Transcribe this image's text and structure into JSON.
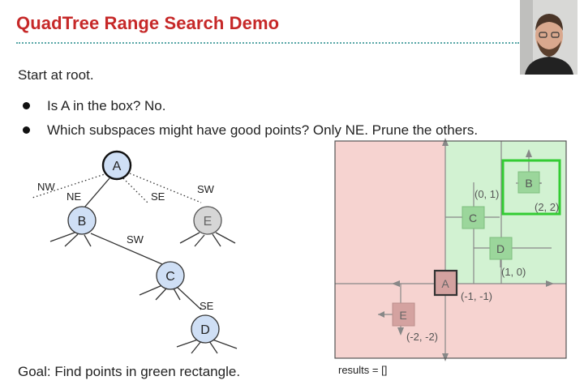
{
  "slide": {
    "title": "QuadTree Range Search Demo",
    "intro": "Start at root.",
    "bullets": [
      "Is A in the box? No.",
      "Which subspaces might have good points? Only NE. Prune the others."
    ],
    "goal": "Goal: Find points in green rectangle.",
    "results": "results = []"
  },
  "tree": {
    "nodes": {
      "A": "A",
      "B": "B",
      "C": "C",
      "D": "D",
      "E": "E"
    },
    "edge_labels": {
      "nw": "NW",
      "ne": "NE",
      "se": "SE",
      "sw": "SW",
      "b_sw": "SW",
      "c_se": "SE"
    }
  },
  "plot": {
    "points": {
      "A": "A",
      "B": "B",
      "C": "C",
      "D": "D",
      "E": "E"
    },
    "coords": {
      "a": "(-1, -1)",
      "b": "(2, 2)",
      "c": "(0, 1)",
      "d": "(1, 0)",
      "e": "(-2, -2)"
    }
  },
  "colors": {
    "title": "#c62828",
    "pruned_region": "#f6d3d0",
    "active_region": "#d2f2d2",
    "query_box": "#33cc33",
    "tree_node": "#cfdff5",
    "pruned_node": "#d6d6d6"
  }
}
